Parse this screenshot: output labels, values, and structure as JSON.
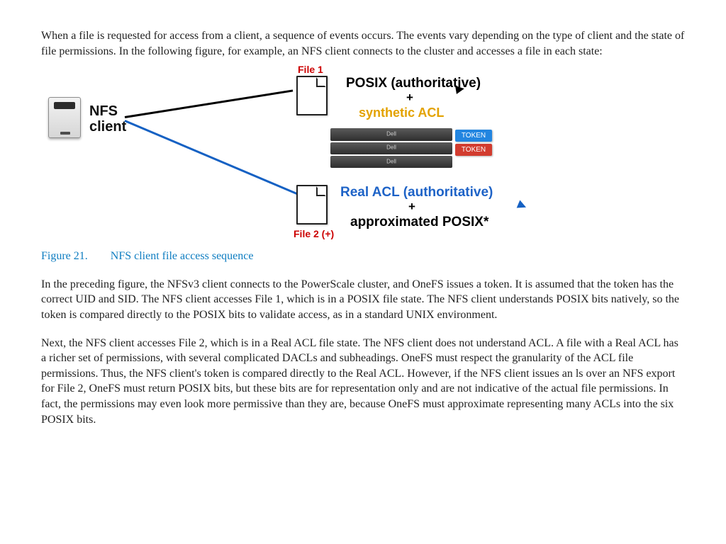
{
  "intro_para": "When a file is requested for access from a client, a sequence of events occurs. The events vary depending on the type of client and the state of file permissions. In the following figure, for example, an NFS client connects to the cluster and accesses a file in each state:",
  "figure": {
    "number": "Figure 21.",
    "caption": "NFS client file access sequence",
    "diagram": {
      "nfs_client_line1": "NFS",
      "nfs_client_line2": "client",
      "file1_label": "File 1",
      "file2_label": "File 2 (+)",
      "posix_auth": "POSIX (authoritative)",
      "plus1": "+",
      "synthetic_acl": "synthetic ACL",
      "token_blue": "TOKEN",
      "token_red": "TOKEN",
      "real_acl": "Real ACL (authoritative)",
      "plus2": "+",
      "approx_posix": "approximated POSIX*"
    }
  },
  "para2": "In the preceding figure, the NFSv3 client connects to the PowerScale cluster, and OneFS issues a token. It is assumed that the token has the correct UID and SID. The NFS client accesses File 1, which is in a POSIX file state. The NFS client understands POSIX bits natively, so the token is compared directly to the POSIX bits to validate access, as in a standard UNIX environment.",
  "para3": "Next, the NFS client accesses File 2, which is in a Real ACL file state. The NFS client does not understand ACL. A file with a Real ACL has a richer set of permissions, with several complicated DACLs and subheadings. OneFS must respect the granularity of the ACL file permissions. Thus, the NFS client's token is compared directly to the Real ACL. However, if the NFS client issues an ls over an NFS export for File 2, OneFS must return POSIX bits, but these bits are for representation only and are not indicative of the actual file permissions. In fact, the permissions may even look more permissive than they are, because OneFS must approximate representing many ACLs into the six POSIX bits."
}
